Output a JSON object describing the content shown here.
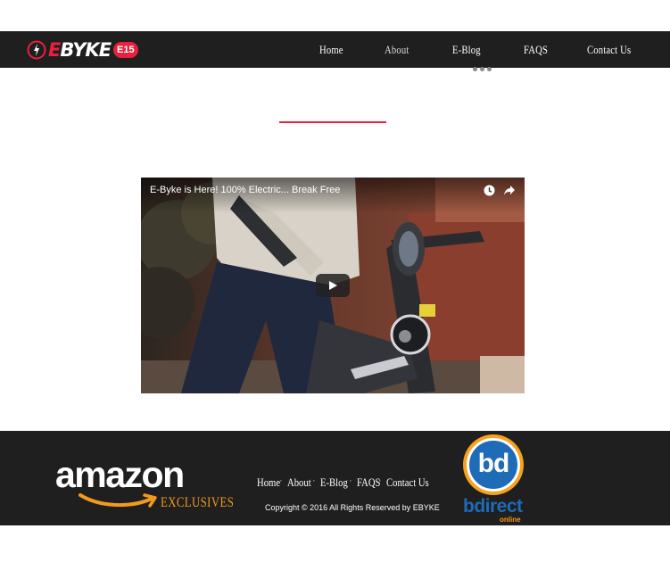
{
  "header": {
    "logo": {
      "brand_first": "E",
      "brand_rest": "BYKE",
      "badge": "E15"
    },
    "nav": [
      {
        "label": "Home"
      },
      {
        "label": "About"
      },
      {
        "label": "E-Blog"
      },
      {
        "label": "FAQS"
      },
      {
        "label": "Contact Us"
      }
    ]
  },
  "video": {
    "title": "E-Byke is Here! 100% Electric... Break Free",
    "icons": [
      "clock-icon",
      "share-icon",
      "play-icon"
    ]
  },
  "footer": {
    "amazon": {
      "word": "amazon",
      "tagline": "EXCLUSIVES"
    },
    "nav": [
      {
        "label": "Home"
      },
      {
        "label": "About"
      },
      {
        "label": "E-Blog"
      },
      {
        "label": "FAQS"
      },
      {
        "label": "Contact Us"
      }
    ],
    "separator": "·",
    "copyright": "Copyright © 2016 All Rights Reserved by EBYKE",
    "bdirect": {
      "mark": "bd",
      "word": "bdirect",
      "sub": "online"
    }
  },
  "colors": {
    "accent": "#e8203d",
    "header_bg": "#1f1f1f",
    "amazon_orange": "#f39a1c",
    "bdirect_blue": "#1e6bb8"
  }
}
